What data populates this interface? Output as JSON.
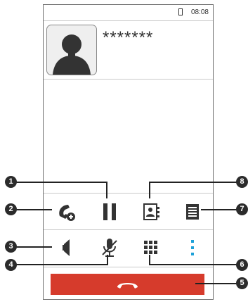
{
  "status_bar": {
    "time": "08:08",
    "battery_icon": "battery-icon"
  },
  "contact": {
    "name": "*******",
    "avatar_icon": "person-silhouette-icon"
  },
  "controls": {
    "row1": [
      {
        "id": "add-call",
        "icon": "add-call-icon"
      },
      {
        "id": "hold",
        "icon": "pause-icon"
      },
      {
        "id": "contacts",
        "icon": "contacts-icon"
      },
      {
        "id": "notepad",
        "icon": "notepad-icon"
      }
    ],
    "row2": [
      {
        "id": "speaker",
        "icon": "speaker-icon"
      },
      {
        "id": "mute",
        "icon": "mute-microphone-icon"
      },
      {
        "id": "dialpad",
        "icon": "dialpad-icon"
      },
      {
        "id": "more",
        "icon": "more-vertical-icon"
      }
    ],
    "end_call_icon": "end-call-icon"
  },
  "callouts": {
    "1": "1",
    "2": "2",
    "3": "3",
    "4": "4",
    "5": "5",
    "6": "6",
    "7": "7",
    "8": "8"
  },
  "colors": {
    "end_call": "#d63b2c",
    "accent": "#1ea1d8",
    "badge": "#2b2b2b"
  }
}
